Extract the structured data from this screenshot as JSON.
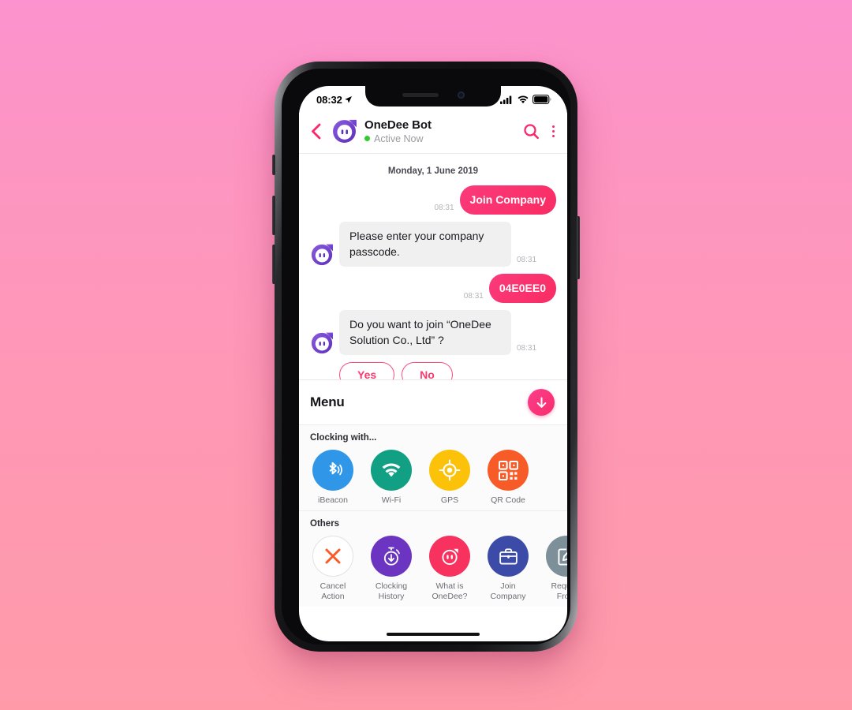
{
  "statusbar": {
    "time": "08:32",
    "location_icon": "location-arrow-icon",
    "signal_icon": "cellular-signal-icon",
    "wifi_icon": "wifi-icon",
    "battery_icon": "battery-full-icon"
  },
  "header": {
    "back_icon": "chevron-left-icon",
    "avatar_icon": "onedee-bot-avatar",
    "title": "OneDee Bot",
    "status": "Active Now",
    "status_color": "#2fcb2f",
    "search_icon": "search-icon",
    "more_icon": "more-vertical-icon"
  },
  "chat": {
    "day_label": "Monday, 1 June 2019",
    "messages": [
      {
        "side": "out",
        "text": "Join Company",
        "time": "08:31"
      },
      {
        "side": "in",
        "text": "Please enter your company passcode.",
        "time": "08:31"
      },
      {
        "side": "out",
        "text": "04E0EE0",
        "time": "08:31"
      },
      {
        "side": "in",
        "text": "Do you want to join “OneDee Solution Co., Ltd” ?",
        "time": "08:31"
      }
    ],
    "choices": [
      {
        "label": "Yes"
      },
      {
        "label": "No"
      }
    ]
  },
  "menu": {
    "title": "Menu",
    "collapse_icon": "arrow-down-icon",
    "accent": "#F92C6E",
    "sections": [
      {
        "title": "Clocking with...",
        "items": [
          {
            "label": "iBeacon",
            "icon": "bluetooth-icon",
            "color": "#2F96E8"
          },
          {
            "label": "Wi-Fi",
            "icon": "wifi-icon",
            "color": "#12A085"
          },
          {
            "label": "GPS",
            "icon": "gps-target-icon",
            "color": "#FCC209"
          },
          {
            "label": "QR Code",
            "icon": "qr-code-icon",
            "color": "#F75B28"
          }
        ]
      },
      {
        "title": "Others",
        "items": [
          {
            "label": "Cancel Action",
            "icon": "close-x-icon",
            "color": "#FFFFFF"
          },
          {
            "label": "Clocking History",
            "icon": "stopwatch-down-icon",
            "color": "#6B35C2"
          },
          {
            "label": "What is OneDee?",
            "icon": "onedee-face-icon",
            "color": "#F7325E"
          },
          {
            "label": "Join Company",
            "icon": "briefcase-icon",
            "color": "#3D4BA8"
          },
          {
            "label": "Request From",
            "icon": "edit-square-icon",
            "color": "#7D9099"
          }
        ]
      }
    ]
  }
}
